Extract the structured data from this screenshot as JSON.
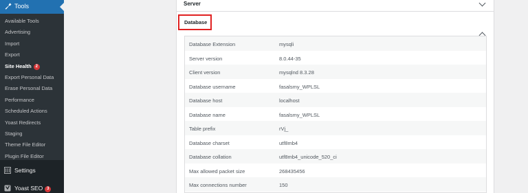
{
  "sidebar": {
    "tools_label": "Tools",
    "submenu": [
      {
        "label": "Available Tools",
        "name": "sidebar-item-available-tools"
      },
      {
        "label": "Advertising",
        "name": "sidebar-item-advertising"
      },
      {
        "label": "Import",
        "name": "sidebar-item-import"
      },
      {
        "label": "Export",
        "name": "sidebar-item-export"
      },
      {
        "label": "Site Health",
        "name": "sidebar-item-site-health",
        "current": true,
        "badge": "2"
      },
      {
        "label": "Export Personal Data",
        "name": "sidebar-item-export-personal-data"
      },
      {
        "label": "Erase Personal Data",
        "name": "sidebar-item-erase-personal-data"
      },
      {
        "label": "Performance",
        "name": "sidebar-item-performance"
      },
      {
        "label": "Scheduled Actions",
        "name": "sidebar-item-scheduled-actions"
      },
      {
        "label": "Yoast Redirects",
        "name": "sidebar-item-yoast-redirects"
      },
      {
        "label": "Staging",
        "name": "sidebar-item-staging"
      },
      {
        "label": "Theme File Editor",
        "name": "sidebar-item-theme-file-editor"
      },
      {
        "label": "Plugin File Editor",
        "name": "sidebar-item-plugin-file-editor"
      }
    ],
    "settings_label": "Settings",
    "yoast_label": "Yoast SEO",
    "yoast_badge": "3"
  },
  "accordion": {
    "server_label": "Server",
    "database_label": "Database"
  },
  "database_rows": [
    {
      "key": "Database Extension",
      "value": "mysqli"
    },
    {
      "key": "Server version",
      "value": "8.0.44-35"
    },
    {
      "key": "Client version",
      "value": "mysqlnd 8.3.28"
    },
    {
      "key": "Database username",
      "value": "fasalsmy_WPLSL"
    },
    {
      "key": "Database host",
      "value": "localhost"
    },
    {
      "key": "Database name",
      "value": "fasalsmy_WPLSL"
    },
    {
      "key": "Table prefix",
      "value": "rVj_"
    },
    {
      "key": "Database charset",
      "value": "utf8mb4"
    },
    {
      "key": "Database collation",
      "value": "utf8mb4_unicode_520_ci"
    },
    {
      "key": "Max allowed packet size",
      "value": "268435456"
    },
    {
      "key": "Max connections number",
      "value": "150"
    }
  ],
  "colors": {
    "sidebar_bg": "#1d2327",
    "submenu_bg": "#2c3338",
    "accent": "#2271b1",
    "badge": "#d63638",
    "highlight_border": "#e02020"
  }
}
